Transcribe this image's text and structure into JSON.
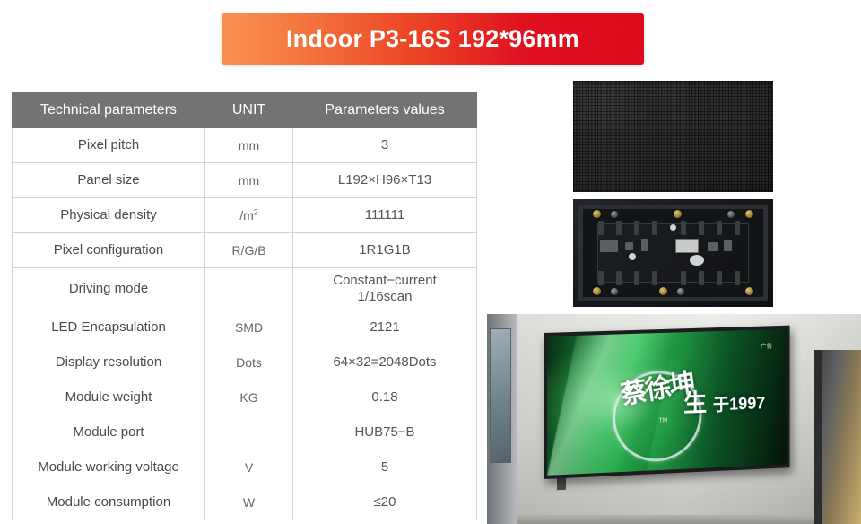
{
  "banner": {
    "title": "Indoor P3-16S 192*96mm",
    "gradient_from": "#f89254",
    "gradient_to": "#db0a1c",
    "text_color": "#ffffff"
  },
  "table": {
    "header_bg": "#737373",
    "header": [
      "Technical parameters",
      "UNIT",
      "Parameters values"
    ],
    "rows": [
      {
        "parameter": "Pixel pitch",
        "unit": "mm",
        "unit_sup": "",
        "value": "3",
        "value_line2": ""
      },
      {
        "parameter": "Panel size",
        "unit": "mm",
        "unit_sup": "",
        "value": "L192×H96×T13",
        "value_line2": ""
      },
      {
        "parameter": "Physical density",
        "unit": "/m",
        "unit_sup": "2",
        "value": "111111",
        "value_line2": ""
      },
      {
        "parameter": "Pixel configuration",
        "unit": "R/G/B",
        "unit_sup": "",
        "value": "1R1G1B",
        "value_line2": ""
      },
      {
        "parameter": "Driving mode",
        "unit": "",
        "unit_sup": "",
        "value": "Constant−current",
        "value_line2": "1/16scan"
      },
      {
        "parameter": "LED Encapsulation",
        "unit": "SMD",
        "unit_sup": "",
        "value": "2121",
        "value_line2": ""
      },
      {
        "parameter": "Display resolution",
        "unit": "Dots",
        "unit_sup": "",
        "value": "64×32=2048Dots",
        "value_line2": ""
      },
      {
        "parameter": "Module weight",
        "unit": "KG",
        "unit_sup": "",
        "value": "0.18",
        "value_line2": ""
      },
      {
        "parameter": "Module port",
        "unit": "",
        "unit_sup": "",
        "value": "HUB75−B",
        "value_line2": ""
      },
      {
        "parameter": "Module working voltage",
        "unit": "V",
        "unit_sup": "",
        "value": "5",
        "value_line2": ""
      },
      {
        "parameter": "Module consumption",
        "unit": "W",
        "unit_sup": "",
        "value": "≤20",
        "value_line2": ""
      }
    ]
  },
  "images": {
    "module_front": {
      "name": "led-module-front-photo"
    },
    "module_back": {
      "name": "led-module-back-pcb-photo"
    },
    "install": {
      "name": "led-screen-installation-photo",
      "screen_logo": "蔡徐坤",
      "screen_slogan_big": "生",
      "screen_slogan_year": "于1997",
      "screen_corner_tag": "广告",
      "screen_tm": "TM"
    }
  }
}
